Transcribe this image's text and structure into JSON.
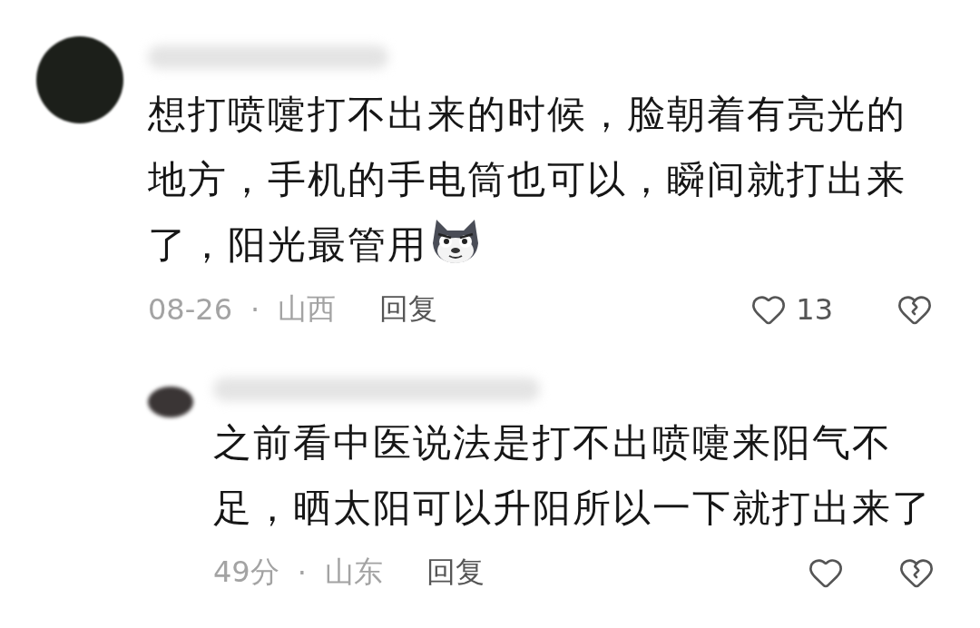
{
  "comments": [
    {
      "text": "想打喷嚏打不出来的时候，脸朝着有亮光的地方，手机的手电筒也可以，瞬间就打出来了，阳光最管用",
      "has_emoji": true,
      "time": "08-26",
      "separator": "·",
      "location": "山西",
      "reply": "回复",
      "likes": "13",
      "replies": [
        {
          "text": "之前看中医说法是打不出喷嚏来阳气不足，晒太阳可以升阳所以一下就打出来了",
          "time": "49分",
          "separator": "·",
          "location": "山东",
          "reply": "回复"
        }
      ]
    }
  ]
}
